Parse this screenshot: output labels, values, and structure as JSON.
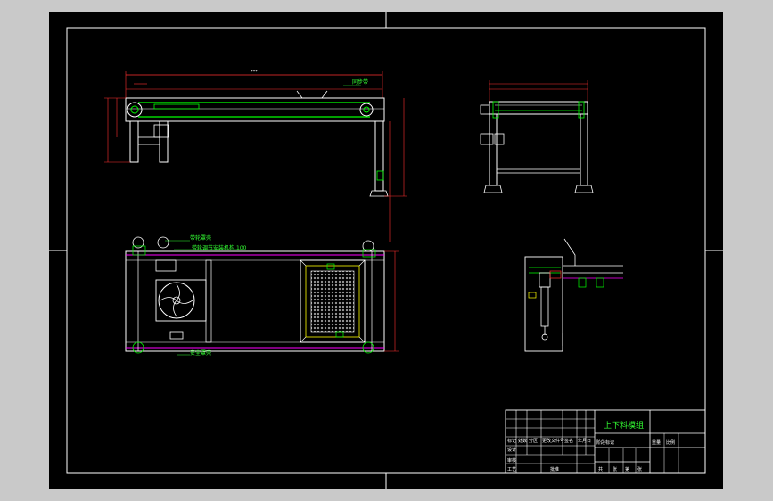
{
  "drawing": {
    "title": "上下料模组",
    "annotations": {
      "top_right_label": "同步带",
      "callout_1": "带轮罩壳",
      "callout_2": "带轮调节安装机构",
      "callout_3": "安全罩壳",
      "callout_suffix": "100"
    },
    "top_dim_label": "***",
    "title_block": {
      "row_labels": [
        "设计",
        "审核",
        "工艺"
      ],
      "col_labels": [
        "标记",
        "处数",
        "分区",
        "更改文件号",
        "签名",
        "年月日"
      ],
      "extra_labels": [
        "阶段标记",
        "重量",
        "比例",
        "共",
        "张",
        "第",
        "张"
      ],
      "approve_label": "批准"
    },
    "colors": {
      "sheet": "#000000",
      "viewport": "#c9c9c9",
      "line_white": "#ffffff",
      "line_green": "#00ff00",
      "line_magenta": "#ff00ff",
      "line_red": "#ff3030",
      "line_yellow": "#ffff00",
      "text_green": "#33ff33"
    }
  }
}
